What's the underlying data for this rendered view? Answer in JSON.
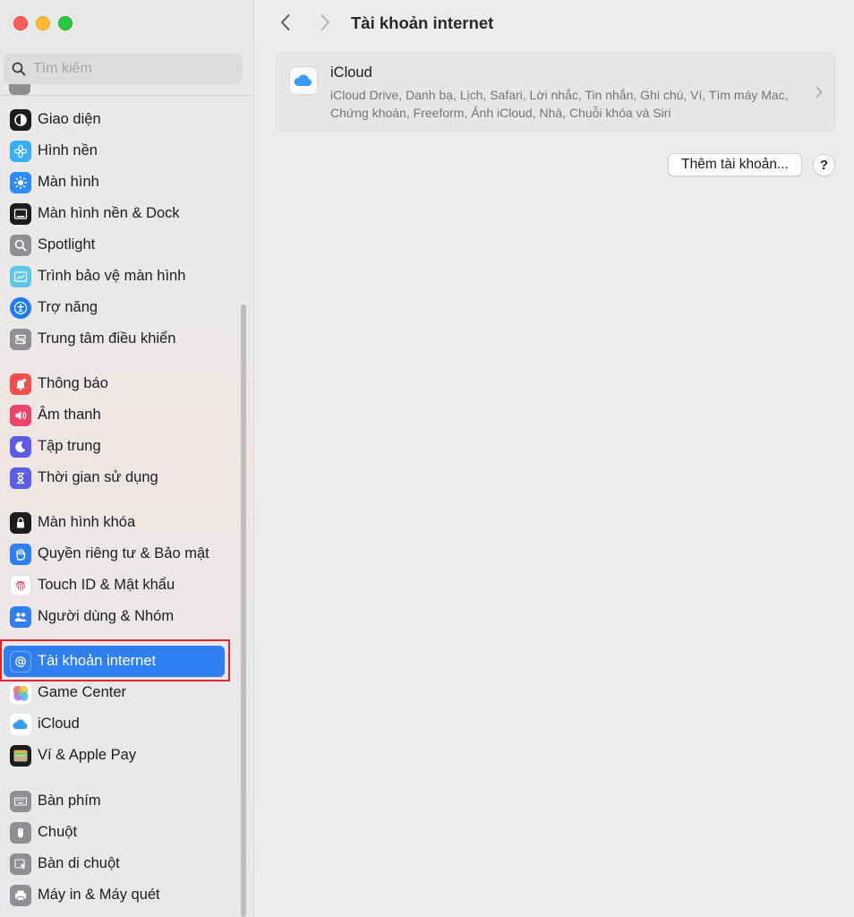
{
  "window": {
    "title": "Tài khoản internet"
  },
  "search": {
    "placeholder": "Tìm kiếm"
  },
  "sidebar": {
    "items": [
      {
        "label": "Giao diện",
        "icon": "appearance-icon",
        "color": "#1c1c1e"
      },
      {
        "label": "Hình nền",
        "icon": "wallpaper-flower-icon",
        "color": "#38aef5"
      },
      {
        "label": "Màn hình",
        "icon": "display-sun-icon",
        "color": "#2f8cf5"
      },
      {
        "label": "Màn hình nền & Dock",
        "icon": "desktop-dock-icon",
        "color": "#1c1c1e"
      },
      {
        "label": "Spotlight",
        "icon": "magnifier-icon",
        "color": "#8e8e93"
      },
      {
        "label": "Trình bảo vệ màn hình",
        "icon": "screensaver-icon",
        "color": "#5ac8e6"
      },
      {
        "label": "Trợ năng",
        "icon": "accessibility-icon",
        "color": "#1f7bf2"
      },
      {
        "label": "Trung tâm điều khiển",
        "icon": "control-center-icon",
        "color": "#8e8e93"
      },
      {
        "label": "Thông báo",
        "icon": "bell-icon",
        "color": "#f24e4e"
      },
      {
        "label": "Âm thanh",
        "icon": "speaker-icon",
        "color": "#f0436a"
      },
      {
        "label": "Tập trung",
        "icon": "moon-icon",
        "color": "#5d5ce6"
      },
      {
        "label": "Thời gian sử dụng",
        "icon": "hourglass-icon",
        "color": "#5d5ce6"
      },
      {
        "label": "Màn hình khóa",
        "icon": "lock-icon",
        "color": "#1c1c1e"
      },
      {
        "label": "Quyền riêng tư & Bảo mật",
        "icon": "hand-icon",
        "color": "#2f7ff0"
      },
      {
        "label": "Touch ID & Mật khẩu",
        "icon": "fingerprint-icon",
        "color": "#ffffff"
      },
      {
        "label": "Người dùng & Nhóm",
        "icon": "users-icon",
        "color": "#2f7ff0"
      },
      {
        "label": "Tài khoản internet",
        "icon": "at-sign-icon",
        "color": "#2f7ff0"
      },
      {
        "label": "Game Center",
        "icon": "game-center-icon",
        "color": "#ffffff"
      },
      {
        "label": "iCloud",
        "icon": "cloud-icon",
        "color": "#ffffff"
      },
      {
        "label": "Ví & Apple Pay",
        "icon": "wallet-icon",
        "color": "#1c1c1e"
      },
      {
        "label": "Bàn phím",
        "icon": "keyboard-icon",
        "color": "#8e8e93"
      },
      {
        "label": "Chuột",
        "icon": "mouse-icon",
        "color": "#8e8e93"
      },
      {
        "label": "Bàn di chuột",
        "icon": "trackpad-icon",
        "color": "#8e8e93"
      },
      {
        "label": "Máy in & Máy quét",
        "icon": "printer-icon",
        "color": "#8e8e93"
      }
    ],
    "selected": "Tài khoản internet"
  },
  "main": {
    "account": {
      "name": "iCloud",
      "services": "iCloud Drive, Danh bạ, Lịch, Safari, Lời nhắc, Tin nhắn, Ghi chú, Ví, Tìm máy Mac, Chứng khoán, Freeform, Ảnh iCloud, Nhà, Chuỗi khóa và Siri"
    },
    "add_account_label": "Thêm tài khoản...",
    "help_label": "?"
  },
  "colors": {
    "accent": "#2f7ff0",
    "highlight_box": "#e0252f"
  }
}
